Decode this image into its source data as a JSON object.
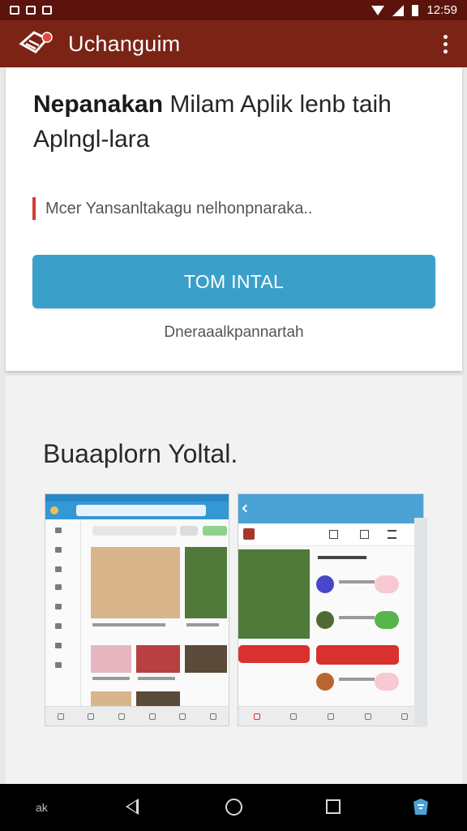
{
  "status_bar": {
    "time": "12:59",
    "icons": [
      "notification-icon",
      "notification-icon",
      "image-icon",
      "wifi-icon",
      "signal-icon",
      "battery-icon"
    ]
  },
  "app_bar": {
    "title": "Uchanguim",
    "logo_icon": "app-logo-icon",
    "menu_icon": "overflow-menu-icon",
    "background": "#7b2416"
  },
  "card": {
    "headline_bold": "Nepanakan",
    "headline_rest": " Milam Aplik lenb taih Aplngl-lara",
    "notice_text": "Mcer Yansanltakagu nelhonpnaraka..",
    "notice_accent": "#d23b35",
    "install_button": "TOM INTAL",
    "install_color": "#3aa0ca",
    "sub_link": "Dneraaalkpannartah"
  },
  "section": {
    "title": "Buaaplorn Yoltal."
  },
  "nav_bar": {
    "left_text": "ak",
    "icons": [
      "back-icon",
      "home-icon",
      "recent-apps-icon",
      "app-shortcut-icon"
    ]
  }
}
